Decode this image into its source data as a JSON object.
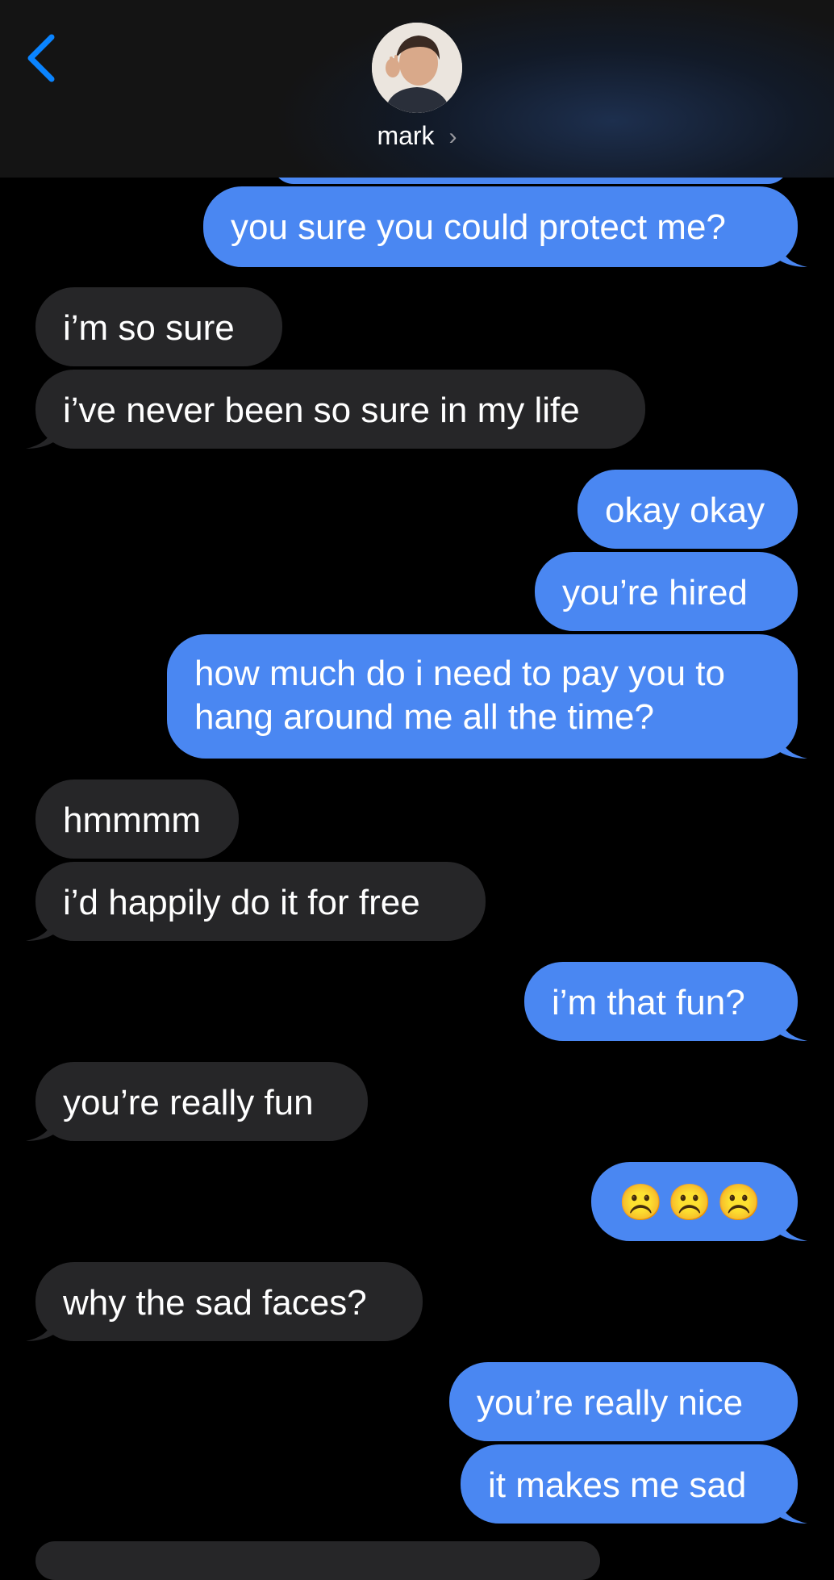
{
  "header": {
    "contact_name": "mark",
    "chevron": "›",
    "back_icon": "chevron-left-icon"
  },
  "colors": {
    "sent_bubble": "#4a87f2",
    "received_bubble": "#262628",
    "accent": "#0a84ff",
    "background": "#000000"
  },
  "messages": [
    {
      "from": "me",
      "text": "you sure you could protect me?"
    },
    {
      "from": "mark",
      "text": "i’m so sure"
    },
    {
      "from": "mark",
      "text": "i’ve never been so sure in my life"
    },
    {
      "from": "me",
      "text": "okay okay"
    },
    {
      "from": "me",
      "text": "you’re hired"
    },
    {
      "from": "me",
      "text_line1": "how much do i need to pay you to",
      "text_line2": "hang around me all the time?"
    },
    {
      "from": "mark",
      "text": "hmmmm"
    },
    {
      "from": "mark",
      "text": "i’d happily do it for free"
    },
    {
      "from": "me",
      "text": "i’m that fun?"
    },
    {
      "from": "mark",
      "text": "you’re really fun"
    },
    {
      "from": "me",
      "text": "☹️☹️☹️"
    },
    {
      "from": "mark",
      "text": "why the sad faces?"
    },
    {
      "from": "me",
      "text": "you’re really nice"
    },
    {
      "from": "me",
      "text": "it makes me sad"
    }
  ]
}
